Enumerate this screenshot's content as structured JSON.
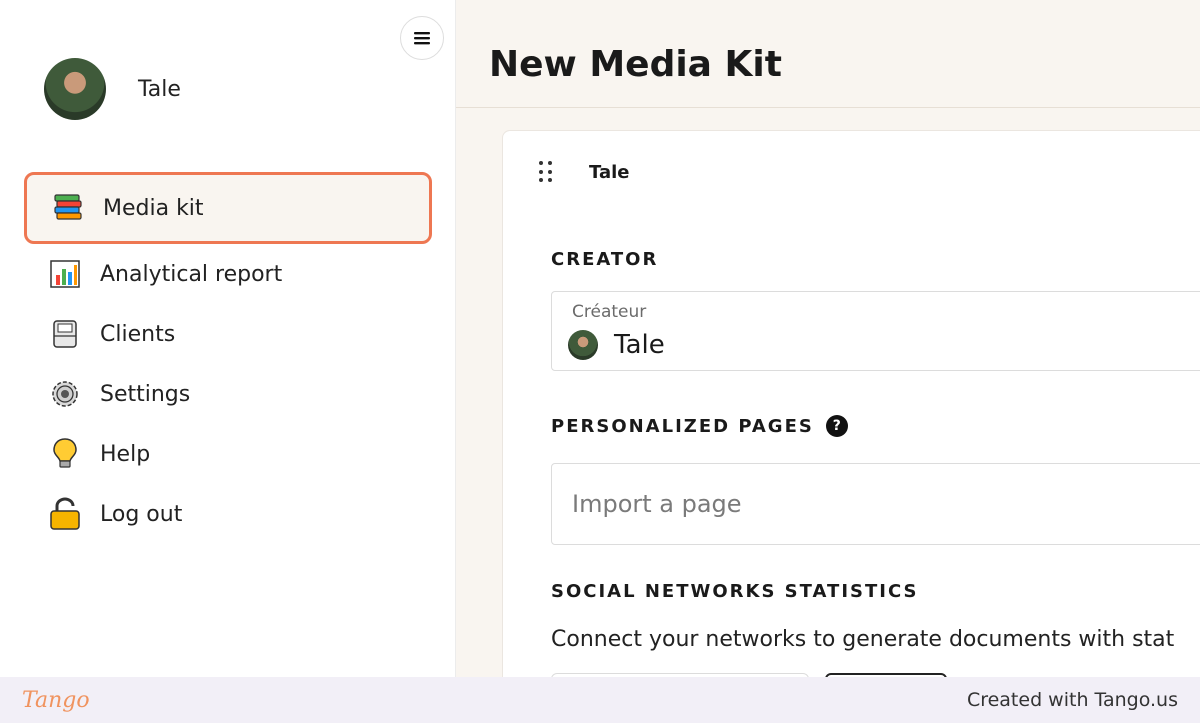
{
  "sidebar": {
    "profile_name": "Tale",
    "items": [
      {
        "label": "Media kit",
        "icon": "books-icon",
        "active": true
      },
      {
        "label": "Analytical report",
        "icon": "bar-chart-icon"
      },
      {
        "label": "Clients",
        "icon": "card-index-icon"
      },
      {
        "label": "Settings",
        "icon": "gear-icon"
      },
      {
        "label": "Help",
        "icon": "lightbulb-icon"
      },
      {
        "label": "Log out",
        "icon": "padlock-icon"
      }
    ]
  },
  "main": {
    "title": "New Media Kit",
    "card": {
      "title": "Tale",
      "creator_section": "CREATOR",
      "creator_field_label": "Créateur",
      "creator_field_value": "Tale",
      "pages_section": "PERSONALIZED PAGES",
      "pages_help_glyph": "?",
      "pages_placeholder": "Import a page",
      "social_section": "SOCIAL NETWORKS STATISTICS",
      "social_text": "Connect your networks to generate documents with stat"
    }
  },
  "footer": {
    "brand": "Tango",
    "credit": "Created with Tango.us"
  },
  "colors": {
    "accent": "#ee7752",
    "main_bg": "#f9f5f0",
    "footer_bg": "#f2eff7"
  }
}
